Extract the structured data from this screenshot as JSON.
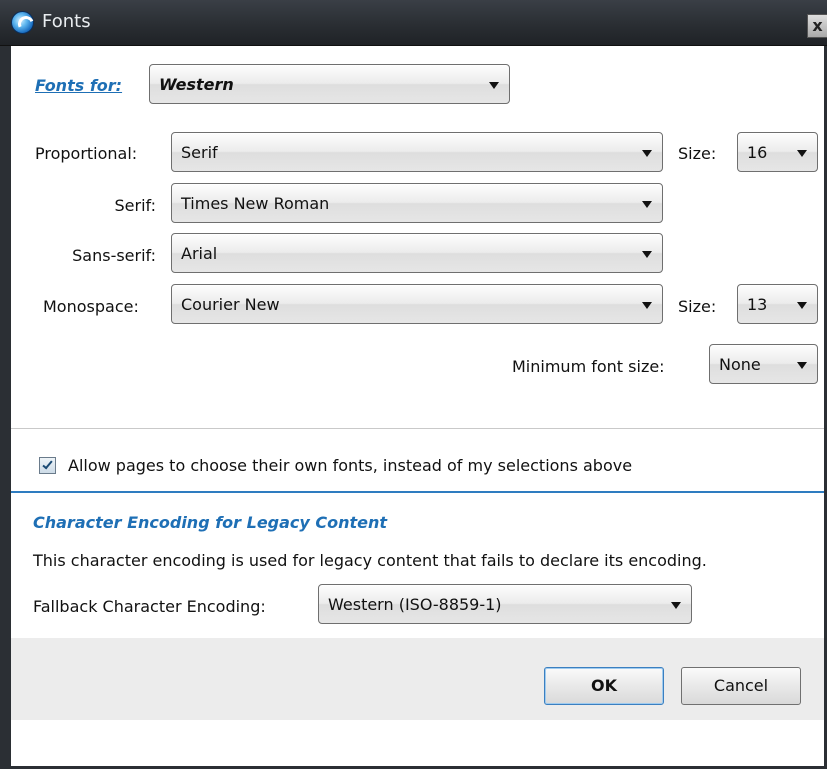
{
  "window": {
    "title": "Fonts"
  },
  "fonts_for": {
    "label": "Fonts for:",
    "value": "Western"
  },
  "proportional": {
    "label": "Proportional:",
    "value": "Serif",
    "size_label": "Size:",
    "size_value": "16"
  },
  "serif": {
    "label": "Serif:",
    "value": "Times New Roman"
  },
  "sans_serif": {
    "label": "Sans-serif:",
    "value": "Arial"
  },
  "monospace": {
    "label": "Monospace:",
    "value": "Courier New",
    "size_label": "Size:",
    "size_value": "13"
  },
  "minimum_font_size": {
    "label": "Minimum font size:",
    "value": "None"
  },
  "allow_pages": {
    "label": "Allow pages to choose their own fonts, instead of my selections above",
    "checked": true
  },
  "encoding": {
    "heading": "Character Encoding for Legacy Content",
    "description": "This character encoding is used for legacy content that fails to declare its encoding.",
    "fallback_label": "Fallback Character Encoding:",
    "fallback_value": "Western (ISO-8859-1)"
  },
  "buttons": {
    "ok": "OK",
    "cancel": "Cancel"
  },
  "icons": {
    "app": "app-logo-icon",
    "close": "close-icon",
    "dropdown": "chevron-down-icon",
    "checkbox": "checkmark-icon"
  },
  "colors": {
    "accent": "#1e6fb5",
    "separator": "#2e7cc0",
    "titlebar": "#2a2e33"
  }
}
